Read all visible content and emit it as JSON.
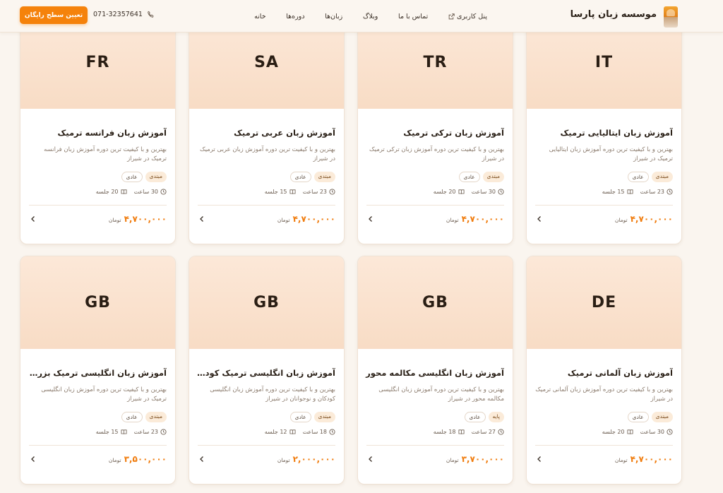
{
  "header": {
    "brand": "موسسه زبان پارسا",
    "nav": [
      {
        "label": "خانه"
      },
      {
        "label": "دوره‌ها"
      },
      {
        "label": "زبان‌ها"
      },
      {
        "label": "وبلاگ"
      },
      {
        "label": "تماس با ما"
      },
      {
        "label": "پنل کاربری"
      }
    ],
    "phone": "071-32357641",
    "cta": "تعیین سطح رایگان"
  },
  "price_unit": "تومان",
  "courses": [
    {
      "code": "IT",
      "title": "آموزش زبان ایتالیایی ترمیک",
      "desc": "بهترین و با کیفیت ترین دوره آموزش زبان ایتالیایی ترمیک در شیراز",
      "level": "مبتدی",
      "type": "عادی",
      "hours": "23 ساعت",
      "sessions": "15 جلسه",
      "price": "۴,۷۰۰,۰۰۰"
    },
    {
      "code": "TR",
      "title": "آموزش زبان ترکی ترمیک",
      "desc": "بهترین و با کیفیت ترین دوره آموزش زبان ترکی ترمیک در شیراز",
      "level": "مبتدی",
      "type": "عادی",
      "hours": "30 ساعت",
      "sessions": "20 جلسه",
      "price": "۴,۷۰۰,۰۰۰"
    },
    {
      "code": "SA",
      "title": "آموزش زبان عربی ترمیک",
      "desc": "بهترین و با کیفیت ترین دوره آموزش زبان عربی ترمیک در شیراز",
      "level": "مبتدی",
      "type": "عادی",
      "hours": "23 ساعت",
      "sessions": "15 جلسه",
      "price": "۴,۷۰۰,۰۰۰"
    },
    {
      "code": "FR",
      "title": "آموزش زبان فرانسه ترمیک",
      "desc": "بهترین و با کیفیت ترین دوره آموزش زبان فرانسه ترمیک در شیراز",
      "level": "مبتدی",
      "type": "عادی",
      "hours": "30 ساعت",
      "sessions": "20 جلسه",
      "price": "۴,۷۰۰,۰۰۰"
    },
    {
      "code": "DE",
      "title": "آموزش زبان آلمانی ترمیک",
      "desc": "بهترین و با کیفیت ترین دوره آموزش زبان آلمانی ترمیک در شیراز",
      "level": "مبتدی",
      "type": "عادی",
      "hours": "30 ساعت",
      "sessions": "20 جلسه",
      "price": "۴,۷۰۰,۰۰۰"
    },
    {
      "code": "GB",
      "title": "آموزش زبان انگلیسی مکالمه محور",
      "desc": "بهترین و با کیفیت ترین دوره آموزش زبان انگلیسی مکالمه محور در شیراز",
      "level": "پایه",
      "type": "عادی",
      "hours": "27 ساعت",
      "sessions": "18 جلسه",
      "price": "۳,۷۰۰,۰۰۰"
    },
    {
      "code": "GB",
      "title": "آموزش زبان انگلیسی ترمیک کودکان ...",
      "desc": "بهترین و با کیفیت ترین دوره آموزش زبان انگلیسی کودکان و نوجوانان در شیراز",
      "level": "مبتدی",
      "type": "عادی",
      "hours": "18 ساعت",
      "sessions": "12 جلسه",
      "price": "۲,۰۰۰,۰۰۰"
    },
    {
      "code": "GB",
      "title": "آموزش زبان انگلیسی ترمیک بزرگسالان",
      "desc": "بهترین و با کیفیت ترین دوره آموزش زبان انگلیسی ترمیک در شیراز",
      "level": "مبتدی",
      "type": "عادی",
      "hours": "23 ساعت",
      "sessions": "15 جلسه",
      "price": "۳,۵۰۰,۰۰۰"
    }
  ]
}
